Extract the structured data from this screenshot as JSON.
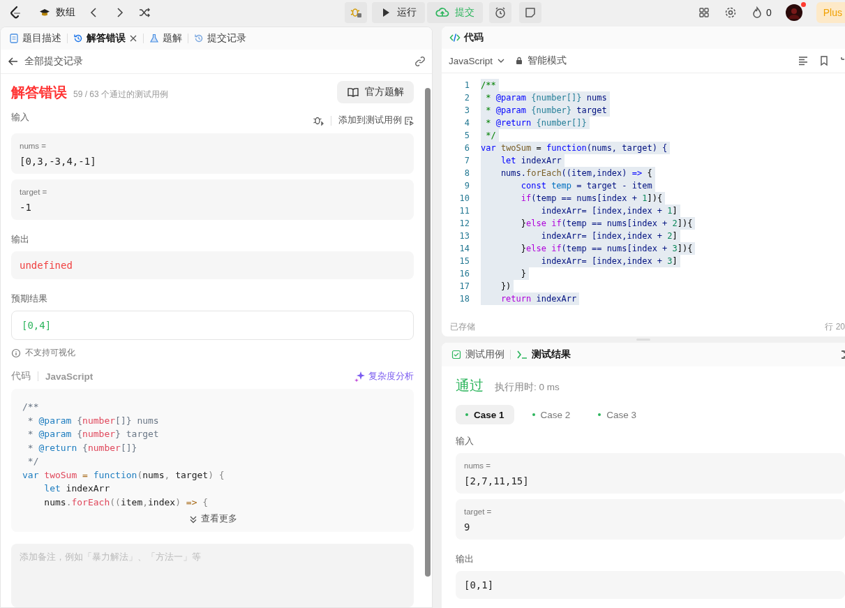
{
  "top_bar": {
    "problem_title": "数组",
    "run_button": "运行",
    "submit_button": "提交",
    "streak_count": "0",
    "plus_label": "Plus"
  },
  "left_panel": {
    "tabs": [
      {
        "label": "题目描述",
        "kind": "description",
        "selected": false,
        "closable": false
      },
      {
        "label": "解答错误",
        "kind": "history",
        "selected": true,
        "closable": true
      },
      {
        "label": "题解",
        "kind": "flask",
        "selected": false,
        "closable": false
      },
      {
        "label": "提交记录",
        "kind": "history",
        "selected": false,
        "closable": false
      }
    ],
    "back_link": "全部提交记录",
    "status": "解答错误",
    "passed_summary": "59 / 63 个通过的测试用例",
    "official_solution_button": "官方题解",
    "input_label": "输入",
    "add_to_testcase": "添加到测试用例",
    "inputs": [
      {
        "name": "nums =",
        "value": "[0,3,-3,4,-1]"
      },
      {
        "name": "target =",
        "value": "-1"
      }
    ],
    "output_label": "输出",
    "output": "undefined",
    "expected_label": "预期结果",
    "expected": "[0,4]",
    "visualize_note": "不支持可视化",
    "code_label": "代码",
    "code_language": "JavaScript",
    "complexity_button": "复杂度分析",
    "code_lines": [
      [
        {
          "text": "/**",
          "kind": "c"
        }
      ],
      [
        {
          "text": " * ",
          "kind": "c"
        },
        {
          "text": "@param",
          "kind": "tag"
        },
        {
          "text": " {",
          "kind": "c"
        },
        {
          "text": "number",
          "kind": "type"
        },
        {
          "text": "[]} nums",
          "kind": "c"
        }
      ],
      [
        {
          "text": " * ",
          "kind": "c"
        },
        {
          "text": "@param",
          "kind": "tag"
        },
        {
          "text": " {",
          "kind": "c"
        },
        {
          "text": "number",
          "kind": "type"
        },
        {
          "text": "} target",
          "kind": "c"
        }
      ],
      [
        {
          "text": " * ",
          "kind": "c"
        },
        {
          "text": "@return",
          "kind": "tag"
        },
        {
          "text": " {",
          "kind": "c"
        },
        {
          "text": "number",
          "kind": "type"
        },
        {
          "text": "[]}",
          "kind": "c"
        }
      ],
      [
        {
          "text": " */",
          "kind": "c"
        }
      ],
      [
        {
          "text": "var",
          "kind": "kw"
        },
        {
          "text": " twoSum",
          "kind": "name"
        },
        {
          "text": " = ",
          "kind": "op"
        },
        {
          "text": "function",
          "kind": "kw"
        },
        {
          "text": "(",
          "kind": "p"
        },
        {
          "text": "nums",
          "kind": "plain"
        },
        {
          "text": ", ",
          "kind": "p"
        },
        {
          "text": "target",
          "kind": "plain"
        },
        {
          "text": ") {",
          "kind": "p"
        }
      ],
      [
        {
          "text": "    let",
          "kind": "kw"
        },
        {
          "text": " indexArr",
          "kind": "plain"
        }
      ],
      [
        {
          "text": "    nums",
          "kind": "plain"
        },
        {
          "text": ".",
          "kind": "p"
        },
        {
          "text": "forEach",
          "kind": "name"
        },
        {
          "text": "((",
          "kind": "p"
        },
        {
          "text": "item",
          "kind": "plain"
        },
        {
          "text": ",",
          "kind": "p"
        },
        {
          "text": "index",
          "kind": "plain"
        },
        {
          "text": ")",
          "kind": "p"
        },
        {
          "text": " =>",
          "kind": "op"
        },
        {
          "text": " {",
          "kind": "p"
        }
      ]
    ],
    "show_more": "查看更多",
    "note_placeholder": "添加备注，例如「暴力解法」、「方法一」等"
  },
  "editor": {
    "title": "代码",
    "language": "JavaScript",
    "mode": "智能模式",
    "saved_status": "已存储",
    "cursor_position": "行 20",
    "lines": [
      {
        "number": "1",
        "selected": true,
        "tokens": [
          {
            "text": "/**",
            "kind": "c"
          }
        ]
      },
      {
        "number": "2",
        "selected": true,
        "tokens": [
          {
            "text": " * ",
            "kind": "c"
          },
          {
            "text": "@param",
            "kind": "doc"
          },
          {
            "text": " {number[]}",
            "kind": "dtype"
          },
          {
            "text": " nums",
            "kind": "var"
          }
        ]
      },
      {
        "number": "3",
        "selected": true,
        "tokens": [
          {
            "text": " * ",
            "kind": "c"
          },
          {
            "text": "@param",
            "kind": "doc"
          },
          {
            "text": " {number}",
            "kind": "dtype"
          },
          {
            "text": " target",
            "kind": "var"
          }
        ]
      },
      {
        "number": "4",
        "selected": true,
        "tokens": [
          {
            "text": " * ",
            "kind": "c"
          },
          {
            "text": "@return",
            "kind": "doc"
          },
          {
            "text": " {number[]}",
            "kind": "dtype"
          }
        ]
      },
      {
        "number": "5",
        "selected": true,
        "tokens": [
          {
            "text": " */",
            "kind": "c"
          }
        ]
      },
      {
        "number": "6",
        "selected": true,
        "tokens": [
          {
            "text": "var",
            "kind": "kw"
          },
          {
            "text": " twoSum",
            "kind": "fn"
          },
          {
            "text": " = ",
            "kind": "plain"
          },
          {
            "text": "function",
            "kind": "kw"
          },
          {
            "text": "(nums, target) {",
            "kind": "var"
          }
        ]
      },
      {
        "number": "7",
        "selected": true,
        "tokens": [
          {
            "text": "    let",
            "kind": "kw"
          },
          {
            "text": " indexArr",
            "kind": "var"
          }
        ]
      },
      {
        "number": "8",
        "selected": true,
        "tokens": [
          {
            "text": "    nums.",
            "kind": "var"
          },
          {
            "text": "forEach",
            "kind": "fn"
          },
          {
            "text": "((item,index) ",
            "kind": "var"
          },
          {
            "text": "=>",
            "kind": "kw"
          },
          {
            "text": " {",
            "kind": "plain"
          }
        ]
      },
      {
        "number": "9",
        "selected": true,
        "tokens": [
          {
            "text": "        const",
            "kind": "kw"
          },
          {
            "text": " temp",
            "kind": "const"
          },
          {
            "text": " = target - item",
            "kind": "var"
          }
        ]
      },
      {
        "number": "10",
        "selected": true,
        "tokens": [
          {
            "text": "        if",
            "kind": "ctl"
          },
          {
            "text": "(temp == nums[index + ",
            "kind": "var"
          },
          {
            "text": "1",
            "kind": "num"
          },
          {
            "text": "]){",
            "kind": "plain"
          }
        ]
      },
      {
        "number": "11",
        "selected": true,
        "tokens": [
          {
            "text": "            indexArr= [index,index + ",
            "kind": "var"
          },
          {
            "text": "1",
            "kind": "num"
          },
          {
            "text": "]",
            "kind": "plain"
          }
        ]
      },
      {
        "number": "12",
        "selected": true,
        "tokens": [
          {
            "text": "        }",
            "kind": "plain"
          },
          {
            "text": "else if",
            "kind": "ctl"
          },
          {
            "text": "(temp == nums[index + ",
            "kind": "var"
          },
          {
            "text": "2",
            "kind": "num"
          },
          {
            "text": "]){",
            "kind": "plain"
          }
        ]
      },
      {
        "number": "13",
        "selected": true,
        "tokens": [
          {
            "text": "            indexArr= [index,index + ",
            "kind": "var"
          },
          {
            "text": "2",
            "kind": "num"
          },
          {
            "text": "]",
            "kind": "plain"
          }
        ]
      },
      {
        "number": "14",
        "selected": true,
        "tokens": [
          {
            "text": "        }",
            "kind": "plain"
          },
          {
            "text": "else if",
            "kind": "ctl"
          },
          {
            "text": "(temp == nums[index + ",
            "kind": "var"
          },
          {
            "text": "3",
            "kind": "num"
          },
          {
            "text": "]){",
            "kind": "plain"
          }
        ]
      },
      {
        "number": "15",
        "selected": true,
        "tokens": [
          {
            "text": "            indexArr= [index,index + ",
            "kind": "var"
          },
          {
            "text": "3",
            "kind": "num"
          },
          {
            "text": "]",
            "kind": "plain"
          }
        ]
      },
      {
        "number": "16",
        "selected": true,
        "tokens": [
          {
            "text": "        }",
            "kind": "plain"
          }
        ]
      },
      {
        "number": "17",
        "selected": true,
        "tokens": [
          {
            "text": "    })",
            "kind": "plain"
          }
        ]
      },
      {
        "number": "18",
        "selected": true,
        "tokens": [
          {
            "text": "    return",
            "kind": "ctl"
          },
          {
            "text": " indexArr",
            "kind": "var"
          }
        ]
      }
    ]
  },
  "test_panel": {
    "tabs": [
      {
        "label": "测试用例",
        "kind": "check",
        "selected": false
      },
      {
        "label": "测试结果",
        "kind": "terminal",
        "selected": true
      }
    ],
    "status": "通过",
    "runtime": "执行用时: 0 ms",
    "cases": [
      {
        "label": "Case 1",
        "selected": true
      },
      {
        "label": "Case 2",
        "selected": false
      },
      {
        "label": "Case 3",
        "selected": false
      }
    ],
    "input_label": "输入",
    "inputs": [
      {
        "name": "nums =",
        "value": "[2,7,11,15]"
      },
      {
        "name": "target =",
        "value": "9"
      }
    ],
    "output_label": "输出",
    "output": "[0,1]"
  }
}
